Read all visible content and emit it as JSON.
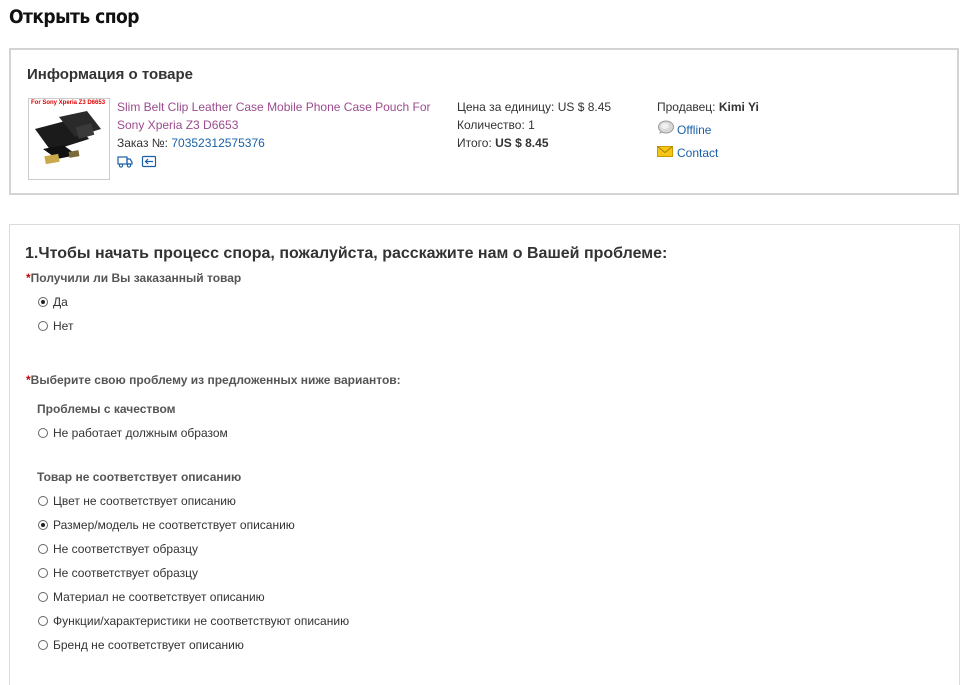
{
  "page": {
    "title": "Открыть спор"
  },
  "product_info": {
    "heading": "Информация о товаре",
    "thumbnail_caption": "For Sony Xperia Z3 D6653",
    "product_name": "Slim Belt Clip Leather Case Mobile Phone Case Pouch For Sony Xperia Z3 D6653",
    "order_label": "Заказ №: ",
    "order_number": "70352312575376",
    "unit_price_label": "Цена за единицу: ",
    "unit_price": "US $ 8.45",
    "quantity_label": "Количество: ",
    "quantity": "1",
    "total_label": "Итого: ",
    "total": "US $ 8.45",
    "seller_label": "Продавец: ",
    "seller_name": "Kimi Yi",
    "status": "Offline",
    "contact_label": "Contact",
    "colors": {
      "product_link": "#9b4b8e",
      "link": "#1a60a8"
    }
  },
  "dispute": {
    "title": "1.Чтобы начать процесс спора, пожалуйста, расскажите нам о Вашей проблеме:",
    "required_mark": "*",
    "q1": {
      "label": "Получили ли Вы заказанный товар",
      "options": [
        {
          "label": "Да",
          "checked": true
        },
        {
          "label": "Нет",
          "checked": false
        }
      ]
    },
    "q2": {
      "label": "Выберите свою проблему из предложенных ниже вариантов:",
      "groups": [
        {
          "label": "Проблемы с качеством",
          "options": [
            {
              "label": "Не работает должным образом",
              "checked": false
            }
          ]
        },
        {
          "label": "Товар не соответствует описанию",
          "options": [
            {
              "label": "Цвет не соответствует описанию",
              "checked": false
            },
            {
              "label": "Размер/модель не соответствует описанию",
              "checked": true
            },
            {
              "label": "Не соответствует образцу",
              "checked": false
            },
            {
              "label": "Не соответствует образцу",
              "checked": false
            },
            {
              "label": "Материал не соответствует описанию",
              "checked": false
            },
            {
              "label": "Функции/характеристики не соответствуют описанию",
              "checked": false
            },
            {
              "label": "Бренд не соответствует описанию",
              "checked": false
            }
          ]
        }
      ]
    }
  }
}
